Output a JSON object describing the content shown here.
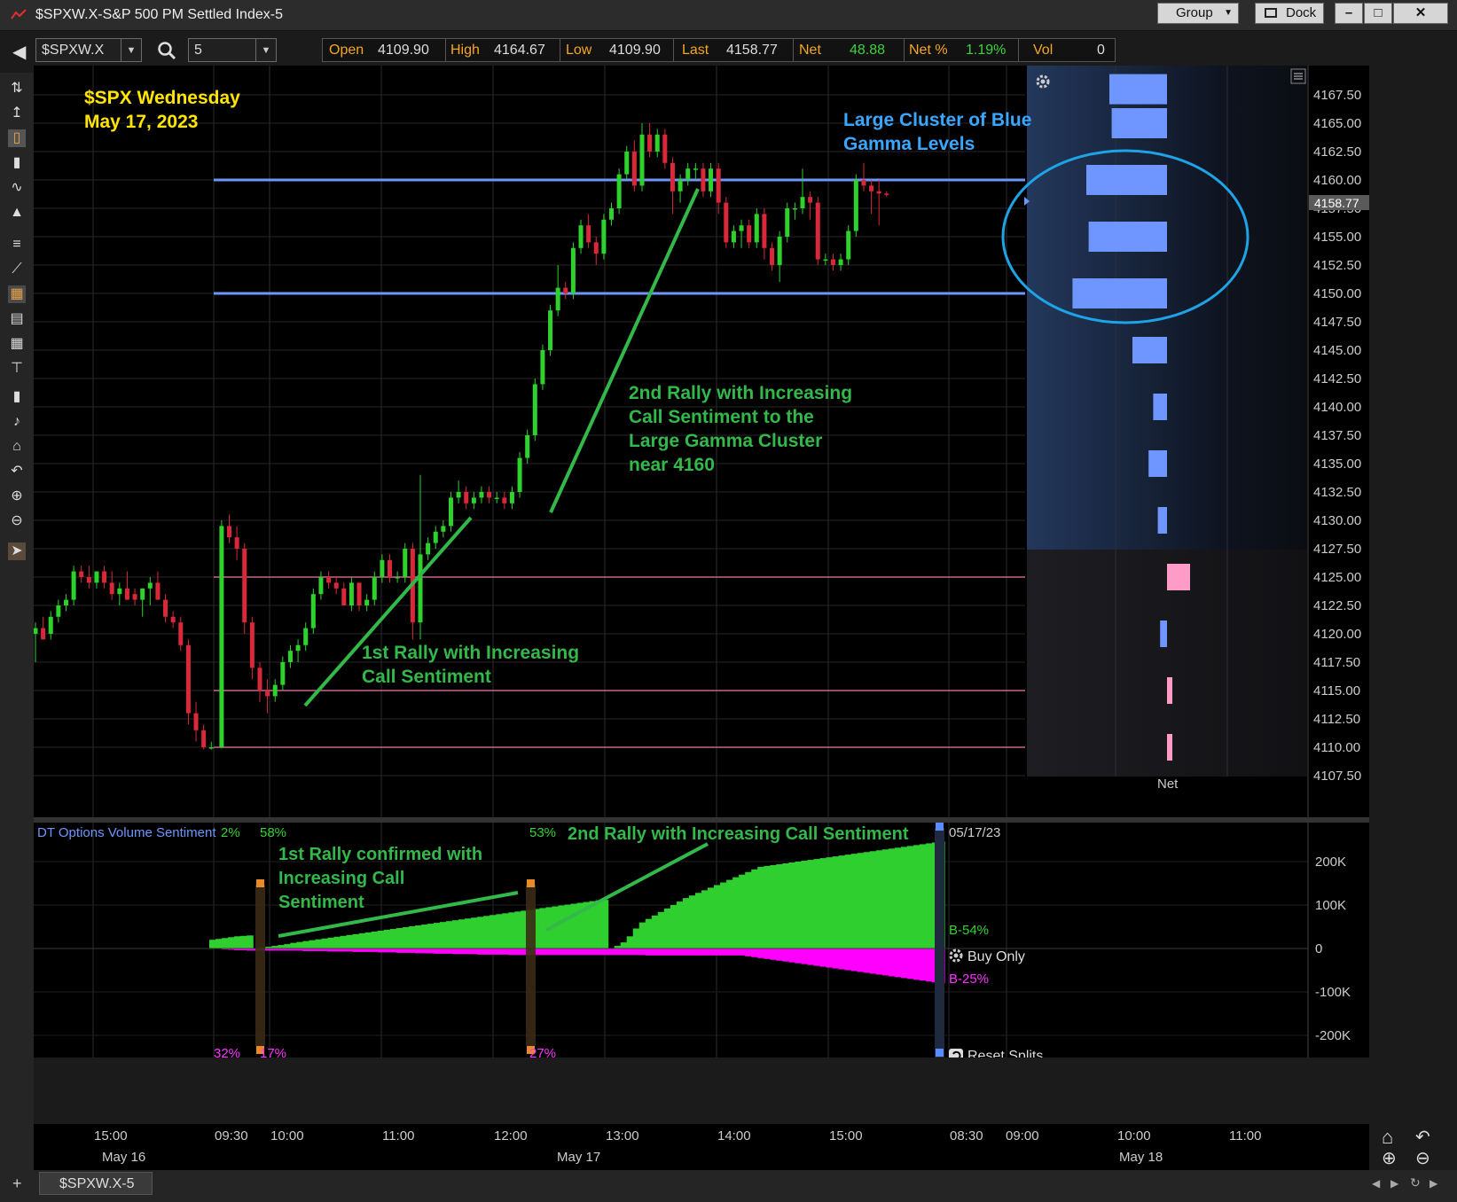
{
  "window": {
    "title": "$SPXW.X-S&P 500 PM Settled Index-5",
    "group_label": "Group",
    "dock_label": "Dock",
    "min_glyph": "–",
    "max_glyph": "□",
    "close_glyph": "✕"
  },
  "toolbar": {
    "symbol": "$SPXW.X",
    "interval": "5",
    "quote": [
      {
        "label": "Open",
        "value": "4109.90"
      },
      {
        "label": "High",
        "value": "4164.67"
      },
      {
        "label": "Low",
        "value": "4109.90"
      },
      {
        "label": "Last",
        "value": "4158.77"
      },
      {
        "label": "Net",
        "value": "48.88"
      },
      {
        "label": "Net %",
        "value": "1.19%"
      },
      {
        "label": "Vol",
        "value": "0"
      }
    ]
  },
  "colors": {
    "up": "#2dd22d",
    "down": "#d9283a",
    "blue_level": "#6f96ff",
    "pink_level": "#f07aa8",
    "annotation_green": "#33b84a",
    "annotation_yellow": "#ffe500",
    "annotation_blue": "#3aa7ff",
    "sentiment_green": "#2fcf2f",
    "sentiment_magenta": "#ff00ff"
  },
  "annotations": {
    "chart_title": [
      "$SPX Wednesday",
      "May 17, 2023"
    ],
    "gamma_title": [
      "Large Cluster of Blue",
      "Gamma Levels"
    ],
    "rally2": [
      "2nd Rally with Increasing",
      "Call Sentiment to the",
      "Large Gamma Cluster",
      "near 4160"
    ],
    "rally1": [
      "1st Rally with Increasing",
      "Call Sentiment"
    ],
    "sent_rally1": [
      "1st Rally confirmed with",
      "Increasing Call",
      "Sentiment"
    ],
    "sent_rally2": "2nd Rally with Increasing Call Sentiment"
  },
  "price_panel": {
    "last_price_label": "4158.77",
    "gamma_axis_label": "Net",
    "icons": [
      "gear-icon",
      "menu-icon"
    ]
  },
  "sentiment_panel": {
    "title": "DT Options Volume Sentiment",
    "title_pct": "2%",
    "split_labels": {
      "s1_top": "58%",
      "s1_bot_a": "32%",
      "s1_bot_b": "17%",
      "s2_top": "53%",
      "s2_bot": "27%"
    },
    "date_label": "05/17/23",
    "buy_pct": "B-54%",
    "sell_pct": "B-25%",
    "buy_only": "Buy Only",
    "reset_splits": "Reset Splits",
    "yticks": [
      "200K",
      "100K",
      "0",
      "-100K",
      "-200K"
    ]
  },
  "time_axis": {
    "ticks": [
      "15:00",
      "09:30",
      "10:00",
      "11:00",
      "12:00",
      "13:00",
      "14:00",
      "15:00",
      "08:30",
      "09:00",
      "10:00",
      "11:00"
    ],
    "dates": [
      "May 16",
      "May 17",
      "May 18"
    ]
  },
  "statusbar": {
    "tab": "$SPXW.X-5"
  },
  "chart_data": [
    {
      "type": "candlestick",
      "title": "$SPX Wednesday May 17, 2023",
      "y_ticks": [
        4107.5,
        4110,
        4112.5,
        4115,
        4117.5,
        4120,
        4122.5,
        4125,
        4127.5,
        4130,
        4132.5,
        4135,
        4137.5,
        4140,
        4142.5,
        4145,
        4147.5,
        4150,
        4152.5,
        4155,
        4157.5,
        4160,
        4162.5,
        4165,
        4167.5
      ],
      "ylim": [
        4105.5,
        4170
      ],
      "horizontal_levels": {
        "blue": [
          4150,
          4160
        ],
        "pink": [
          4110,
          4115,
          4125
        ]
      },
      "candles_ohlc": [
        [
          4120.0,
          4121.0,
          4117.5,
          4120.5
        ],
        [
          4120.5,
          4121.5,
          4119.5,
          4119.5
        ],
        [
          4120.0,
          4122.0,
          4119.5,
          4121.5
        ],
        [
          4121.5,
          4123.0,
          4121.0,
          4122.5
        ],
        [
          4122.5,
          4123.5,
          4122.0,
          4123.0
        ],
        [
          4123.0,
          4126.0,
          4122.5,
          4125.5
        ],
        [
          4125.5,
          4126.0,
          4124.5,
          4125.0
        ],
        [
          4125.0,
          4126.0,
          4124.0,
          4124.5
        ],
        [
          4124.5,
          4125.5,
          4124.0,
          4125.5
        ],
        [
          4125.5,
          4126.0,
          4124.0,
          4124.5
        ],
        [
          4124.5,
          4125.5,
          4123.0,
          4123.5
        ],
        [
          4123.5,
          4124.5,
          4122.5,
          4124.0
        ],
        [
          4124.0,
          4125.5,
          4123.5,
          4123.0
        ],
        [
          4123.5,
          4124.0,
          4122.5,
          4123.0
        ],
        [
          4123.0,
          4124.0,
          4121.5,
          4124.0
        ],
        [
          4124.0,
          4125.0,
          4122.5,
          4124.5
        ],
        [
          4124.5,
          4125.5,
          4123.0,
          4123.0
        ],
        [
          4123.0,
          4123.5,
          4121.0,
          4121.5
        ],
        [
          4121.5,
          4122.0,
          4120.5,
          4121.0
        ],
        [
          4121.0,
          4121.5,
          4118.5,
          4119.0
        ],
        [
          4119.0,
          4119.5,
          4112.0,
          4113.0
        ],
        [
          4113.0,
          4114.0,
          4110.5,
          4111.5
        ],
        [
          4111.5,
          4112.0,
          4109.8,
          4110.0
        ],
        [
          4110.0,
          4110.5,
          4109.8,
          4110.0
        ],
        [
          4110.0,
          4130.0,
          4109.9,
          4129.5
        ],
        [
          4129.5,
          4130.5,
          4128.0,
          4128.5
        ],
        [
          4128.5,
          4129.5,
          4126.5,
          4127.5
        ],
        [
          4127.5,
          4128.0,
          4120.0,
          4121.0
        ],
        [
          4121.0,
          4121.5,
          4116.0,
          4117.0
        ],
        [
          4117.0,
          4117.5,
          4114.0,
          4115.0
        ],
        [
          4115.0,
          4116.0,
          4113.0,
          4114.5
        ],
        [
          4114.5,
          4116.0,
          4114.0,
          4115.5
        ],
        [
          4115.5,
          4118.0,
          4115.0,
          4117.5
        ],
        [
          4117.5,
          4119.0,
          4117.0,
          4118.5
        ],
        [
          4118.5,
          4119.5,
          4117.5,
          4119.0
        ],
        [
          4119.0,
          4121.0,
          4118.5,
          4120.5
        ],
        [
          4120.5,
          4124.0,
          4120.0,
          4123.5
        ],
        [
          4123.5,
          4125.5,
          4123.0,
          4125.0
        ],
        [
          4125.0,
          4125.5,
          4124.0,
          4124.5
        ],
        [
          4124.5,
          4125.0,
          4123.5,
          4124.0
        ],
        [
          4124.0,
          4124.5,
          4122.5,
          4122.5
        ],
        [
          4122.5,
          4125.0,
          4122.0,
          4124.5
        ],
        [
          4124.5,
          4124.5,
          4122.0,
          4122.5
        ],
        [
          4122.5,
          4123.5,
          4122.0,
          4123.0
        ],
        [
          4123.0,
          4125.5,
          4122.5,
          4125.0
        ],
        [
          4125.0,
          4127.0,
          4124.5,
          4126.5
        ],
        [
          4126.5,
          4127.0,
          4124.5,
          4125.0
        ],
        [
          4125.0,
          4125.5,
          4124.5,
          4125.0
        ],
        [
          4125.0,
          4128.0,
          4124.5,
          4127.5
        ],
        [
          4127.5,
          4128.0,
          4119.5,
          4121.0
        ],
        [
          4121.0,
          4134.0,
          4119.5,
          4127.0
        ],
        [
          4127.0,
          4128.5,
          4126.5,
          4128.0
        ],
        [
          4128.0,
          4129.5,
          4127.5,
          4129.0
        ],
        [
          4129.0,
          4130.0,
          4128.5,
          4129.5
        ],
        [
          4129.5,
          4132.5,
          4129.0,
          4132.0
        ],
        [
          4132.0,
          4133.5,
          4131.5,
          4132.5
        ],
        [
          4132.5,
          4133.0,
          4131.0,
          4131.5
        ],
        [
          4131.5,
          4132.5,
          4131.0,
          4132.0
        ],
        [
          4132.0,
          4133.0,
          4131.5,
          4132.5
        ],
        [
          4132.5,
          4133.0,
          4131.5,
          4132.0
        ],
        [
          4132.0,
          4132.5,
          4131.5,
          4132.0
        ],
        [
          4132.0,
          4132.5,
          4131.0,
          4131.5
        ],
        [
          4131.5,
          4133.0,
          4131.0,
          4132.5
        ],
        [
          4132.5,
          4136.0,
          4132.0,
          4135.5
        ],
        [
          4135.5,
          4138.0,
          4135.0,
          4137.5
        ],
        [
          4137.5,
          4142.5,
          4137.0,
          4142.0
        ],
        [
          4142.0,
          4145.5,
          4141.5,
          4145.0
        ],
        [
          4145.0,
          4149.0,
          4144.5,
          4148.5
        ],
        [
          4148.5,
          4152.5,
          4148.0,
          4150.5
        ],
        [
          4150.5,
          4151.0,
          4149.5,
          4150.0
        ],
        [
          4150.0,
          4154.5,
          4149.5,
          4154.0
        ],
        [
          4154.0,
          4156.5,
          4153.5,
          4156.0
        ],
        [
          4156.0,
          4157.0,
          4154.0,
          4154.5
        ],
        [
          4154.5,
          4155.0,
          4152.5,
          4153.5
        ],
        [
          4153.5,
          4157.0,
          4153.0,
          4156.5
        ],
        [
          4156.5,
          4158.0,
          4156.0,
          4157.5
        ],
        [
          4157.5,
          4161.0,
          4157.0,
          4160.5
        ],
        [
          4160.5,
          4163.0,
          4160.0,
          4162.5
        ],
        [
          4162.5,
          4163.5,
          4159.0,
          4159.5
        ],
        [
          4159.5,
          4165.0,
          4159.0,
          4164.0
        ],
        [
          4164.0,
          4165.0,
          4162.0,
          4162.5
        ],
        [
          4162.5,
          4164.5,
          4162.0,
          4164.0
        ],
        [
          4164.0,
          4164.5,
          4161.0,
          4161.5
        ],
        [
          4161.5,
          4162.0,
          4157.0,
          4159.0
        ],
        [
          4159.0,
          4160.5,
          4158.0,
          4160.0
        ],
        [
          4160.0,
          4161.5,
          4159.5,
          4161.0
        ],
        [
          4161.0,
          4161.5,
          4160.0,
          4161.0
        ],
        [
          4161.0,
          4161.5,
          4158.5,
          4159.0
        ],
        [
          4159.0,
          4161.5,
          4158.5,
          4161.0
        ],
        [
          4161.0,
          4161.5,
          4157.0,
          4158.0
        ],
        [
          4158.0,
          4158.5,
          4154.0,
          4154.5
        ],
        [
          4154.5,
          4156.0,
          4154.0,
          4155.5
        ],
        [
          4155.5,
          4156.5,
          4154.0,
          4156.0
        ],
        [
          4156.0,
          4156.5,
          4154.0,
          4154.5
        ],
        [
          4154.5,
          4157.5,
          4154.0,
          4157.0
        ],
        [
          4157.0,
          4157.5,
          4153.0,
          4154.0
        ],
        [
          4154.0,
          4154.5,
          4152.0,
          4152.5
        ],
        [
          4152.5,
          4155.5,
          4151.0,
          4155.0
        ],
        [
          4155.0,
          4158.0,
          4154.5,
          4157.5
        ],
        [
          4157.5,
          4158.0,
          4156.5,
          4157.5
        ],
        [
          4157.5,
          4161.0,
          4157.0,
          4158.5
        ],
        [
          4158.5,
          4159.0,
          4156.5,
          4158.0
        ],
        [
          4158.0,
          4158.5,
          4152.5,
          4153.0
        ],
        [
          4153.0,
          4153.5,
          4152.5,
          4153.0
        ],
        [
          4153.0,
          4153.5,
          4152.0,
          4152.5
        ],
        [
          4152.5,
          4153.5,
          4152.0,
          4153.0
        ],
        [
          4153.0,
          4156.0,
          4152.5,
          4155.5
        ],
        [
          4155.5,
          4160.5,
          4155.0,
          4160.0
        ],
        [
          4160.0,
          4161.5,
          4159.0,
          4159.5
        ],
        [
          4159.5,
          4160.0,
          4157.0,
          4159.0
        ],
        [
          4159.0,
          4160.0,
          4156.0,
          4158.8
        ],
        [
          4158.8,
          4159.0,
          4158.5,
          4158.77
        ]
      ]
    },
    {
      "type": "bar",
      "title": "Net",
      "orientation": "horizontal",
      "y_strikes": [
        4110,
        4115,
        4120,
        4125,
        4130,
        4135,
        4140,
        4145,
        4150,
        4155,
        4160,
        4165,
        4168
      ],
      "values": [
        -1,
        -1,
        3,
        -10,
        4,
        8,
        6,
        15,
        41,
        34,
        35,
        24,
        25
      ],
      "positive_color": "#6f96ff",
      "negative_color": "#ff9bc7"
    },
    {
      "type": "area",
      "title": "DT Options Volume Sentiment",
      "y_ticks": [
        "200K",
        "100K",
        "0",
        "-100K",
        "-200K"
      ],
      "ylim": [
        -250,
        250
      ],
      "buy_values_k": [
        20,
        22,
        24,
        26,
        28,
        29,
        30,
        0,
        2,
        4,
        6,
        8,
        10,
        13,
        15,
        17,
        19,
        21,
        23,
        25,
        27,
        29,
        31,
        33,
        35,
        37,
        39,
        41,
        43,
        45,
        47,
        49,
        51,
        53,
        55,
        57,
        59,
        61,
        63,
        65,
        67,
        69,
        71,
        73,
        75,
        77,
        79,
        81,
        83,
        85,
        87,
        89,
        91,
        93,
        95,
        97,
        99,
        101,
        103,
        105,
        107,
        109,
        111,
        112,
        0,
        6,
        14,
        28,
        46,
        60,
        68,
        76,
        84,
        92,
        100,
        108,
        116,
        122,
        128,
        134,
        140,
        146,
        152,
        158,
        164,
        170,
        176,
        182,
        188,
        190,
        192,
        194,
        196,
        198,
        200,
        202,
        204,
        206,
        208,
        210,
        212,
        214,
        216,
        218,
        220,
        222,
        224,
        226,
        228,
        230,
        232,
        234,
        236,
        238,
        240,
        242,
        244,
        246
      ],
      "sell_values_k": [
        0,
        0,
        -2,
        -3,
        -4,
        -4,
        -5,
        -5,
        -5,
        -5,
        -5,
        -5,
        -5,
        -5,
        -5,
        -6,
        -6,
        -6,
        -6,
        -7,
        -7,
        -7,
        -7,
        -8,
        -8,
        -8,
        -8,
        -9,
        -9,
        -9,
        -10,
        -10,
        -10,
        -11,
        -11,
        -11,
        -12,
        -12,
        -12,
        -13,
        -13,
        -13,
        -13,
        -14,
        -14,
        -14,
        -14,
        -14,
        -15,
        -15,
        -15,
        -15,
        -15,
        -15,
        -15,
        -15,
        -15,
        -15,
        -15,
        -15,
        -15,
        -15,
        -15,
        -15,
        -15,
        -15,
        -15,
        -15,
        -15,
        -15,
        -16,
        -16,
        -16,
        -16,
        -16,
        -16,
        -16,
        -16,
        -16,
        -16,
        -16,
        -16,
        -16,
        -16,
        -16,
        -16,
        -18,
        -20,
        -22,
        -24,
        -26,
        -28,
        -30,
        -32,
        -34,
        -36,
        -38,
        -40,
        -42,
        -44,
        -46,
        -48,
        -50,
        -52,
        -54,
        -56,
        -58,
        -60,
        -62,
        -64,
        -66,
        -68,
        -70,
        -72,
        -74,
        -76,
        -78,
        -80
      ]
    }
  ]
}
